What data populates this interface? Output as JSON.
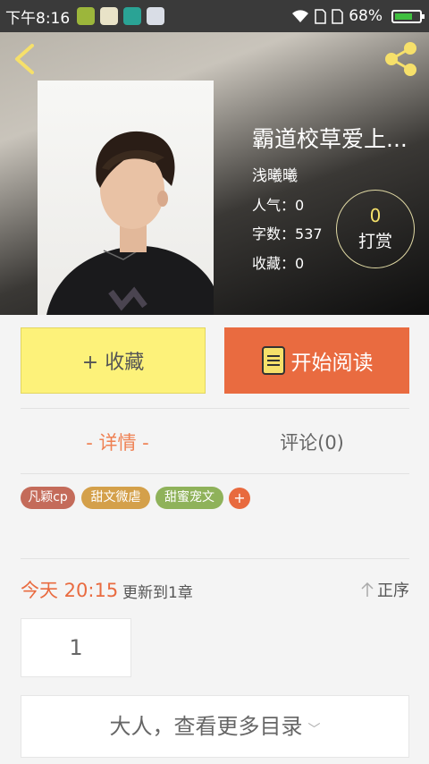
{
  "status_bar": {
    "time": "下午8:16",
    "battery": "68%"
  },
  "book": {
    "title": "霸道校草爱上...",
    "author": "浅曦曦",
    "popularity_label": "人气：",
    "popularity": "0",
    "word_count_label": "字数：",
    "word_count": "537",
    "favorites_label": "收藏：",
    "favorites": "0"
  },
  "reward": {
    "count": "0",
    "label": "打赏"
  },
  "actions": {
    "collect_label": "+ 收藏",
    "read_label": "开始阅读"
  },
  "tabs": [
    {
      "label": "- 详情 -",
      "active": true
    },
    {
      "label": "评论(0)",
      "active": false
    }
  ],
  "tags": [
    {
      "label": "凡颖cp",
      "color": "#c46b5a"
    },
    {
      "label": "甜文微虐",
      "color": "#d4a04a"
    },
    {
      "label": "甜蜜宠文",
      "color": "#8fb25a"
    }
  ],
  "tag_add_label": "+",
  "update": {
    "date": "今天 20:15",
    "text": "更新到1章",
    "sort_label": "正序"
  },
  "chapter_number": "1",
  "more_toc_label": "大人，查看更多目录",
  "colors": {
    "accent": "#e96b40",
    "collect_bg": "#fdf27a",
    "reward_num": "#f5e16a",
    "icon_yellow": "#f6e06a"
  }
}
